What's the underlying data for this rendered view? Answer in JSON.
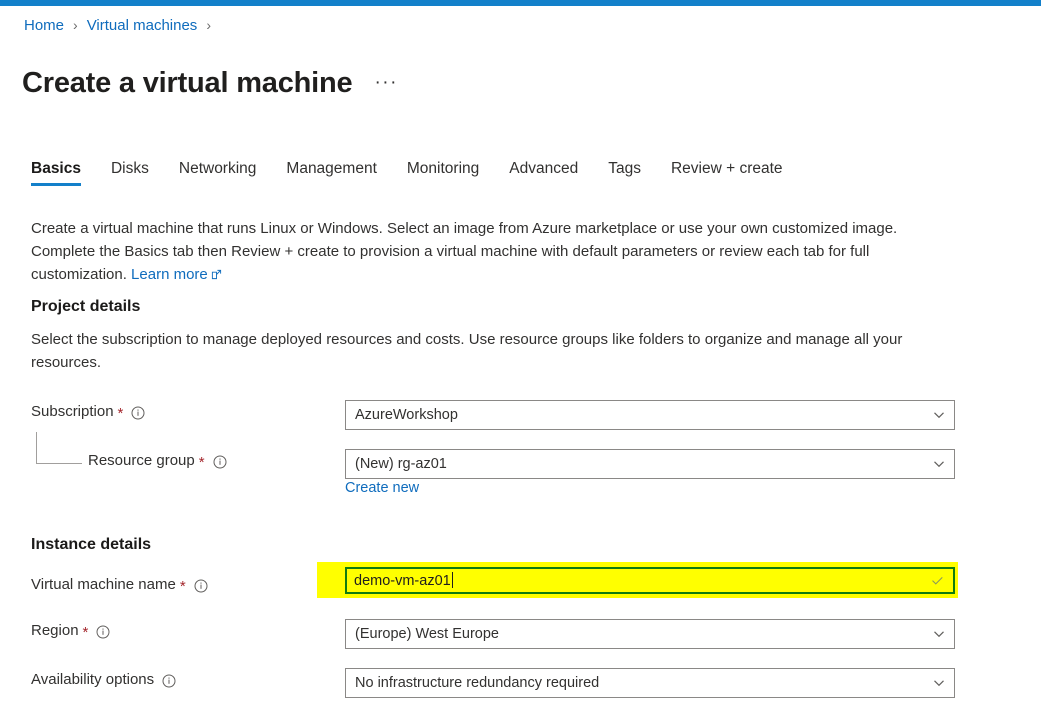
{
  "theme": {
    "top_bar_color": "#1380ca",
    "accent_color": "#0f6cbd",
    "required_color": "#a4262c",
    "highlight_color": "#ffff00",
    "highlight_border_color": "#107c10"
  },
  "breadcrumb": {
    "items": [
      {
        "label": "Home"
      },
      {
        "label": "Virtual machines"
      }
    ],
    "separator": "›"
  },
  "header": {
    "title": "Create a virtual machine",
    "more_label": "···"
  },
  "tabs": [
    {
      "label": "Basics",
      "active": true
    },
    {
      "label": "Disks",
      "active": false
    },
    {
      "label": "Networking",
      "active": false
    },
    {
      "label": "Management",
      "active": false
    },
    {
      "label": "Monitoring",
      "active": false
    },
    {
      "label": "Advanced",
      "active": false
    },
    {
      "label": "Tags",
      "active": false
    },
    {
      "label": "Review + create",
      "active": false
    }
  ],
  "intro": {
    "text": "Create a virtual machine that runs Linux or Windows. Select an image from Azure marketplace or use your own customized image. Complete the Basics tab then Review + create to provision a virtual machine with default parameters or review each tab for full customization. ",
    "link_label": "Learn more"
  },
  "project_details": {
    "heading": "Project details",
    "description": "Select the subscription to manage deployed resources and costs. Use resource groups like folders to organize and manage all your resources.",
    "subscription": {
      "label": "Subscription",
      "required_marker": "*",
      "value": "AzureWorkshop"
    },
    "resource_group": {
      "label": "Resource group",
      "required_marker": "*",
      "value": "(New) rg-az01",
      "create_new_label": "Create new"
    }
  },
  "instance_details": {
    "heading": "Instance details",
    "vm_name": {
      "label": "Virtual machine name",
      "required_marker": "*",
      "value": "demo-vm-az01",
      "highlighted": true,
      "validated": true
    },
    "region": {
      "label": "Region",
      "required_marker": "*",
      "value": "(Europe) West Europe"
    },
    "availability_options": {
      "label": "Availability options",
      "required_marker": "",
      "value": "No infrastructure redundancy required"
    }
  }
}
